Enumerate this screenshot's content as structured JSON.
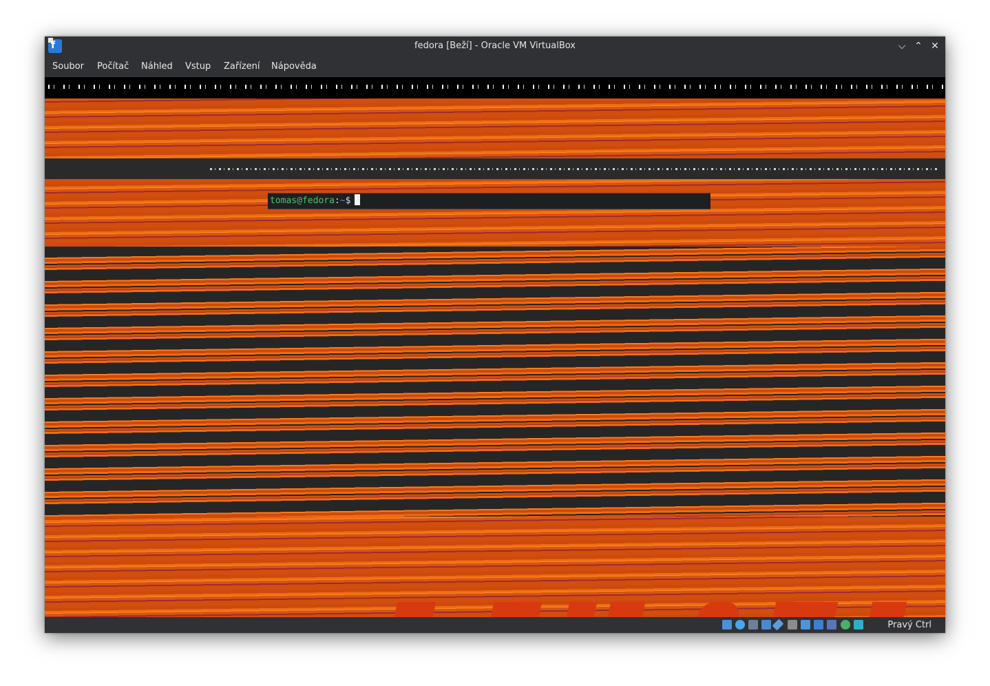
{
  "window": {
    "title": "fedora [Beží] - Oracle VM VirtualBox",
    "icon": "virtualbox-fedora-icon",
    "controls": {
      "minimize": "⌵",
      "maximize": "⌃",
      "close": "✕"
    }
  },
  "menubar": {
    "items": [
      {
        "label": "Soubor"
      },
      {
        "label": "Počítač"
      },
      {
        "label": "Náhled"
      },
      {
        "label": "Vstup"
      },
      {
        "label": "Zařízení"
      },
      {
        "label": "Nápověda"
      }
    ]
  },
  "terminal": {
    "user_host": "tomas@fedora",
    "separator": ":",
    "path": "~",
    "dollar": "$"
  },
  "statusbar": {
    "icons": [
      "hard-disk-icon",
      "optical-drive-icon",
      "audio-icon",
      "network-icon",
      "usb-icon",
      "shared-folders-icon",
      "display-icon",
      "video-capture-icon",
      "virtualization-icon",
      "mouse-integration-icon",
      "keyboard-capture-icon"
    ],
    "host_key": "Pravý Ctrl"
  },
  "colors": {
    "accent_orange": "#ee6d14",
    "terminal_user": "#4ec16a",
    "terminal_path": "#6f8fd9"
  }
}
